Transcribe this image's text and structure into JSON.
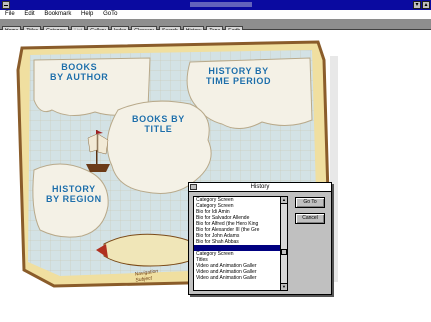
{
  "window": {
    "title": "",
    "min_symbol": "▾",
    "max_symbol": "▴"
  },
  "menu": [
    "File",
    "Edit",
    "Bookmark",
    "Help",
    "GoTo"
  ],
  "toolbar": [
    {
      "label": "Home",
      "enabled": true
    },
    {
      "label": "Titles",
      "enabled": true
    },
    {
      "label": "Category",
      "enabled": true
    },
    {
      "label": "List",
      "enabled": false
    },
    {
      "label": "Gallery",
      "enabled": true
    },
    {
      "label": "Index",
      "enabled": true
    },
    {
      "label": "Glossary",
      "enabled": true
    },
    {
      "label": "Search",
      "enabled": true
    },
    {
      "label": "History",
      "enabled": true
    },
    {
      "label": "Tape",
      "enabled": true
    },
    {
      "label": "Earth",
      "enabled": true
    }
  ],
  "map": {
    "books_by_author": "BOOKS\nBY AUTHOR",
    "history_by_time": "HISTORY BY\nTIME PERIOD",
    "books_by_title": "BOOKS BY\nTITLE",
    "history_by_region": "HISTORY\nBY REGION",
    "scroll_text": "Navigation\nSubject"
  },
  "history_dialog": {
    "title": "History",
    "items": [
      "Category Screen",
      "Category Screen",
      "Bio for Idi Amin",
      "Bio for Salvador Allende",
      "Bio for Alfred (the Hero King",
      "Bio for Alexander III (the Gre",
      "Bio for John Adams",
      "Bio for Shah Abbas",
      "",
      "Category Screen",
      "Titles",
      "Video and Animation Galler",
      "Video and Animation Galler",
      "Video and Animation Galler"
    ],
    "selected_index": 8,
    "goto_label": "Go To",
    "cancel_label": "Cancel"
  },
  "colors": {
    "titlebar": "#0a0aa0",
    "map_label": "#1d6ea8",
    "selection": "#000080"
  }
}
